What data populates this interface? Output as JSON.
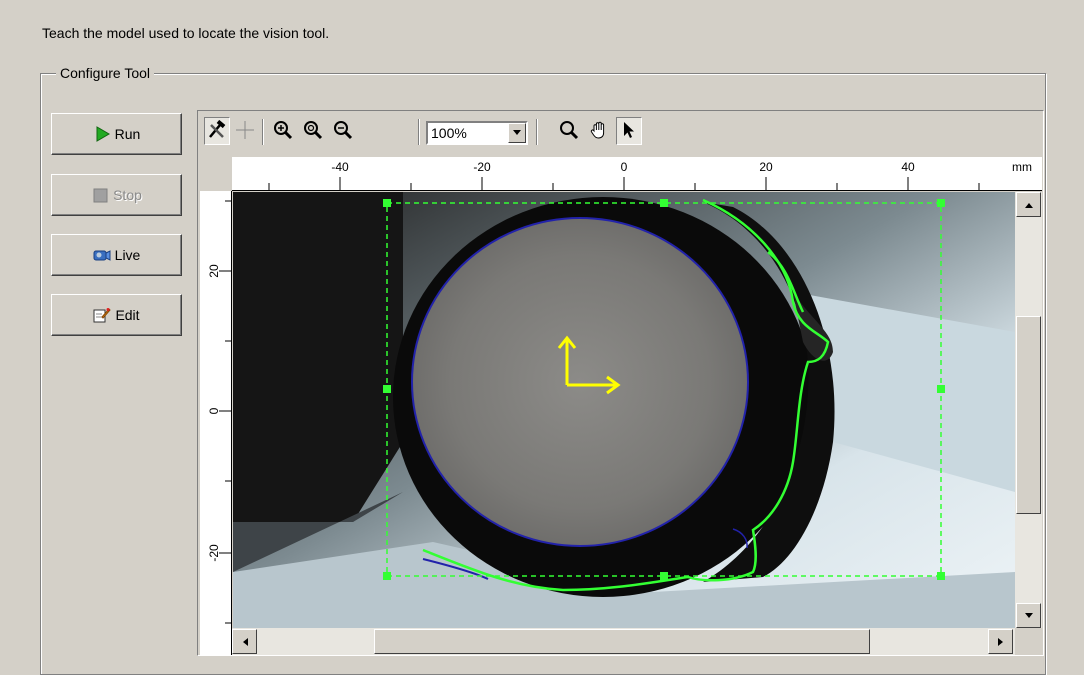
{
  "instruction": "Teach the model used to locate the vision tool.",
  "group_title": "Configure Tool",
  "buttons": {
    "run": "Run",
    "stop": "Stop",
    "live": "Live",
    "edit": "Edit"
  },
  "toolbar": {
    "zoom_value": "100%"
  },
  "ruler": {
    "top_labels": [
      "-40",
      "-20",
      "0",
      "20",
      "40"
    ],
    "unit": "mm",
    "left_labels": [
      "20",
      "0",
      "-20"
    ]
  },
  "icons": {
    "run": "play-arrow-icon",
    "stop": "stop-square-icon",
    "live": "camera-icon",
    "edit": "edit-pencil-icon",
    "tools": "hammer-wrench-icon",
    "crosshair": "crosshair-icon",
    "zoom_in": "zoom-in-icon",
    "zoom_fit": "zoom-fit-icon",
    "zoom_out": "zoom-out-icon",
    "magnify": "magnifier-icon",
    "pan": "hand-icon",
    "pointer": "arrow-pointer-icon"
  },
  "colors": {
    "region": "#33ff33",
    "model_circle": "#2222aa",
    "origin_axes": "#ffff00"
  }
}
